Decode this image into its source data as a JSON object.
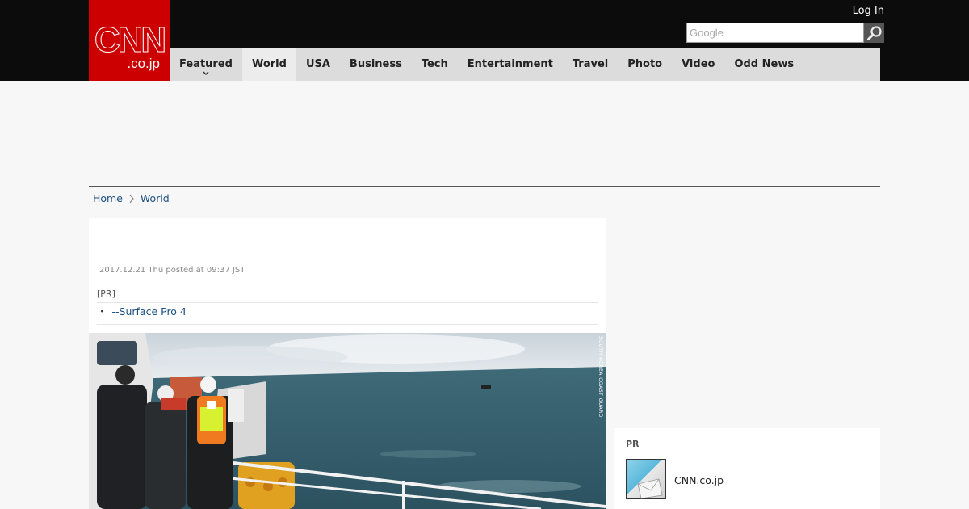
{
  "header": {
    "logo_main": "CNN",
    "logo_sub": ".co.jp",
    "login_label": "Log In",
    "search_placeholder": "Google"
  },
  "nav": {
    "items": [
      {
        "label": "Featured"
      },
      {
        "label": "World"
      },
      {
        "label": "USA"
      },
      {
        "label": "Business"
      },
      {
        "label": "Tech"
      },
      {
        "label": "Entertainment"
      },
      {
        "label": "Travel"
      },
      {
        "label": "Photo"
      },
      {
        "label": "Video"
      },
      {
        "label": "Odd News"
      }
    ],
    "active": "World"
  },
  "breadcrumb": {
    "home": "Home",
    "current": "World"
  },
  "article": {
    "date": "2017.12.21 Thu posted at 09:37 JST",
    "pr_label": "[PR]",
    "pr_bullet": "・",
    "pr_link": "--Surface Pro 4",
    "photo_credit": "SOUTH KOREA COAST GUARD"
  },
  "sidebar": {
    "pr_title": "PR",
    "pr_item": "CNN.co.jp"
  },
  "colors": {
    "brand_red": "#cc0000",
    "header_bg": "#0c0c0c",
    "nav_bg": "#dcdcdc",
    "link": "#1a4f80"
  }
}
